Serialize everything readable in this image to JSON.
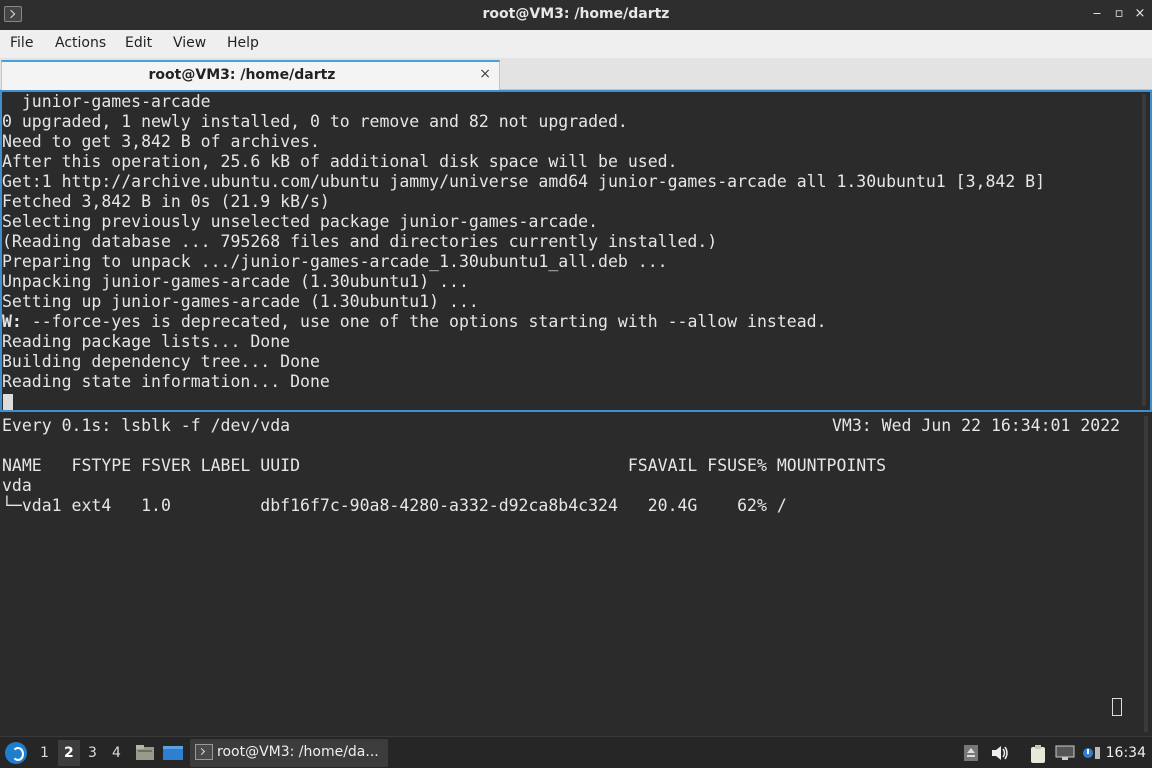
{
  "window": {
    "title": "root@VM3: /home/dartz",
    "buttons": {
      "minimize": "‒",
      "maximize": "▫",
      "close": "×"
    }
  },
  "menu": [
    "File",
    "Actions",
    "Edit",
    "View",
    "Help"
  ],
  "tab": {
    "label": "root@VM3: /home/dartz",
    "close": "×"
  },
  "top_pane": {
    "lines": [
      "  junior-games-arcade",
      "0 upgraded, 1 newly installed, 0 to remove and 82 not upgraded.",
      "Need to get 3,842 B of archives.",
      "After this operation, 25.6 kB of additional disk space will be used.",
      "Get:1 http://archive.ubuntu.com/ubuntu jammy/universe amd64 junior-games-arcade all 1.30ubuntu1 [3,842 B]",
      "Fetched 3,842 B in 0s (21.9 kB/s)",
      "Selecting previously unselected package junior-games-arcade.",
      "(Reading database ... 795268 files and directories currently installed.)",
      "Preparing to unpack .../junior-games-arcade_1.30ubuntu1_all.deb ...",
      "Unpacking junior-games-arcade (1.30ubuntu1) ...",
      "Setting up junior-games-arcade (1.30ubuntu1) ..."
    ],
    "warning_prefix": "W:",
    "warning_text": " --force-yes is deprecated, use one of the options starting with --allow instead.",
    "tail_lines": [
      "Reading package lists... Done",
      "Building dependency tree... Done",
      "Reading state information... Done"
    ]
  },
  "bottom_pane": {
    "watch_header": "Every 0.1s: lsblk -f /dev/vda",
    "watch_status": "VM3: Wed Jun 22 16:34:01 2022",
    "table_header": "NAME   FSTYPE FSVER LABEL UUID                                 FSAVAIL FSUSE% MOUNTPOINTS",
    "rows": [
      "vda",
      "└─vda1 ext4   1.0         dbf16f7c-90a8-4280-a332-d92ca8b4c324   20.4G    62% /"
    ]
  },
  "taskbar": {
    "workspaces": [
      "1",
      "2",
      "3",
      "4"
    ],
    "active_workspace": "2",
    "task_label": "root@VM3: /home/da...",
    "clock": "16:34"
  },
  "colors": {
    "terminal_bg": "#2b2b2b",
    "terminal_fg": "#e6e6e6",
    "focus_border": "#3d8fd0",
    "titlebar_bg": "#2e2e2e",
    "taskbar_bg": "#262626"
  }
}
